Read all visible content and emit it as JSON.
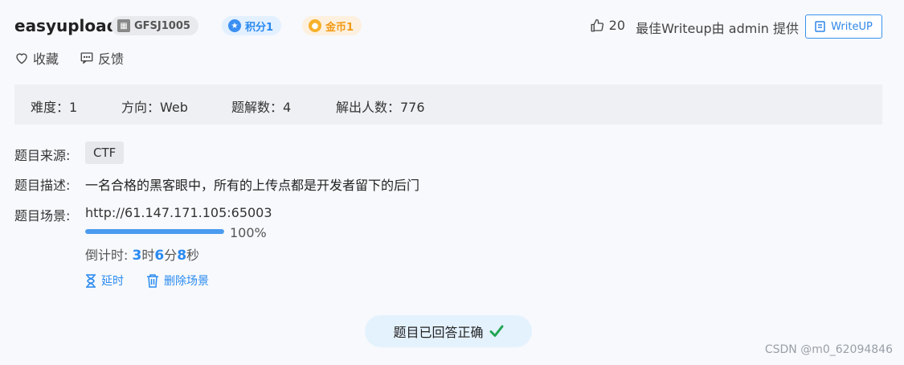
{
  "header": {
    "title": "easyupload",
    "challenge_id": "GFSJ1005",
    "score_label": "积分1",
    "coin_label": "金币1",
    "likes": "20",
    "writeup_note": "最佳Writeup由 admin 提供",
    "writeup_button": "WriteUP"
  },
  "actions": {
    "favorite": "收藏",
    "feedback": "反馈"
  },
  "info": {
    "difficulty": "难度：1",
    "direction": "方向：Web",
    "solves_label": "题解数：4",
    "solvers_label": "解出人数：776"
  },
  "details": {
    "source_label": "题目来源:",
    "source_value": "CTF",
    "desc_label": "题目描述:",
    "desc_value": "一名合格的黑客眼中，所有的上传点都是开发者留下的后门",
    "scene_label": "题目场景:",
    "scene_url": "http://61.147.171.105:65003",
    "progress_percent": "100%",
    "countdown_prefix": "倒计时: ",
    "hours": "3",
    "hours_unit": "时",
    "minutes": "6",
    "minutes_unit": "分",
    "seconds": "8",
    "seconds_unit": "秒",
    "extend_label": "延时",
    "delete_label": "删除场景"
  },
  "status": {
    "answered": "题目已回答正确"
  },
  "watermark": "CSDN @m0_62094846",
  "colors": {
    "accent": "#2a8af0",
    "success": "#22a553",
    "coin": "#f29a15"
  }
}
